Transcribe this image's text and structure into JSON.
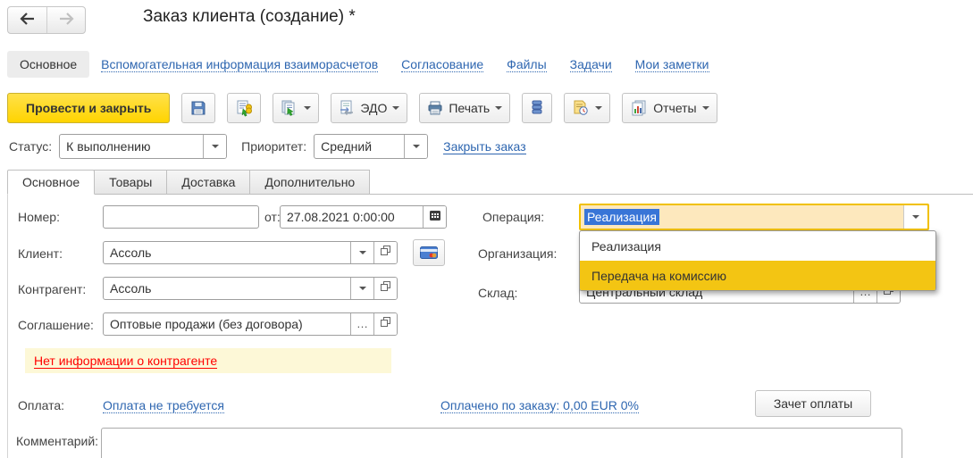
{
  "window": {
    "title": "Заказ клиента (создание) *"
  },
  "nav": {
    "active_tab": "Основное",
    "links": [
      "Вспомогательная информация взаиморасчетов",
      "Согласование",
      "Файлы",
      "Задачи",
      "Мои заметки"
    ]
  },
  "toolbar": {
    "post_and_close": "Провести и закрыть",
    "edo": "ЭДО",
    "print": "Печать",
    "reports": "Отчеты"
  },
  "status_row": {
    "status_label": "Статус:",
    "status_value": "К выполнению",
    "priority_label": "Приоритет:",
    "priority_value": "Средний",
    "close_order": "Закрыть заказ"
  },
  "form_tabs": {
    "main": "Основное",
    "goods": "Товары",
    "delivery": "Доставка",
    "additional": "Дополнительно"
  },
  "form": {
    "number_label": "Номер:",
    "date_label": "от:",
    "date_value": "27.08.2021  0:00:00",
    "operation_label": "Операция:",
    "operation_value": "Реализация",
    "client_label": "Клиент:",
    "client_value": "Ассоль",
    "organization_label": "Организация:",
    "counterparty_label": "Контрагент:",
    "counterparty_value": "Ассоль",
    "warehouse_label": "Склад:",
    "warehouse_value": "Центральный склад",
    "agreement_label": "Соглашение:",
    "agreement_value": "Оптовые продажи (без договора)",
    "comment_label": "Комментарий:"
  },
  "operation_dropdown": {
    "option1": "Реализация",
    "option2": "Передача на комиссию"
  },
  "warning": {
    "text": "Нет информации о контрагенте"
  },
  "payment": {
    "label": "Оплата:",
    "not_required": "Оплата не требуется",
    "paid_info": "Оплачено по заказу: 0,00 EUR 0%",
    "offset_button": "Зачет оплаты"
  },
  "colors": {
    "accent_yellow": "#ffd600",
    "focus_border": "#f1c100",
    "selection_blue": "#3875d7",
    "dropdown_highlight": "#f3c513",
    "warning_bg": "#fdf8d7",
    "link_blue": "#2e66b0",
    "warning_red": "#ff0000"
  }
}
